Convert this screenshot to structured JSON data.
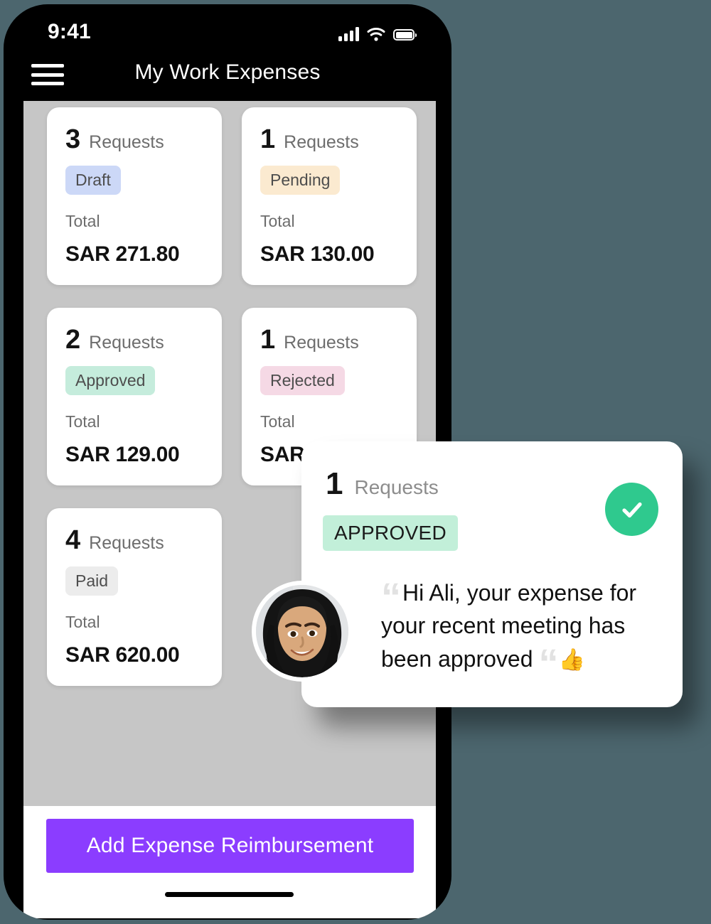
{
  "theme": {
    "background": "#4c666e",
    "device_frame": "#000000",
    "screen_bg": "#c6c6c6",
    "accent": "#8b3dff",
    "success": "#2fc98e"
  },
  "status_bar": {
    "time": "9:41",
    "signal_icon": "signal-bars-icon",
    "wifi_icon": "wifi-icon",
    "battery_icon": "battery-icon"
  },
  "app_bar": {
    "menu_icon": "hamburger-menu-icon",
    "title": "My Work Expenses"
  },
  "expense_cards": [
    {
      "count": "3",
      "count_label": "Requests",
      "status": "Draft",
      "status_color": "#ccd8f7",
      "total_label": "Total",
      "total_value": "SAR 271.80"
    },
    {
      "count": "1",
      "count_label": "Requests",
      "status": "Pending",
      "status_color": "#fbead0",
      "total_label": "Total",
      "total_value": "SAR 130.00"
    },
    {
      "count": "2",
      "count_label": "Requests",
      "status": "Approved",
      "status_color": "#c5ecdc",
      "total_label": "Total",
      "total_value": "SAR 129.00"
    },
    {
      "count": "1",
      "count_label": "Requests",
      "status": "Rejected",
      "status_color": "#f5d9e5",
      "total_label": "Total",
      "total_value": "SAR"
    },
    {
      "count": "4",
      "count_label": "Requests",
      "status": "Paid",
      "status_color": "#ececec",
      "total_label": "Total",
      "total_value": "SAR 620.00"
    }
  ],
  "cta": {
    "label": "Add Expense Reimbursement"
  },
  "notification": {
    "count": "1",
    "count_label": "Requests",
    "badge": "APPROVED",
    "check_icon": "check-circle-icon",
    "avatar": "user-avatar",
    "quote_open": "“",
    "quote_close": "“",
    "message": "Hi Ali, your expense for your recent meeting has been approved",
    "emoji": "👍"
  }
}
